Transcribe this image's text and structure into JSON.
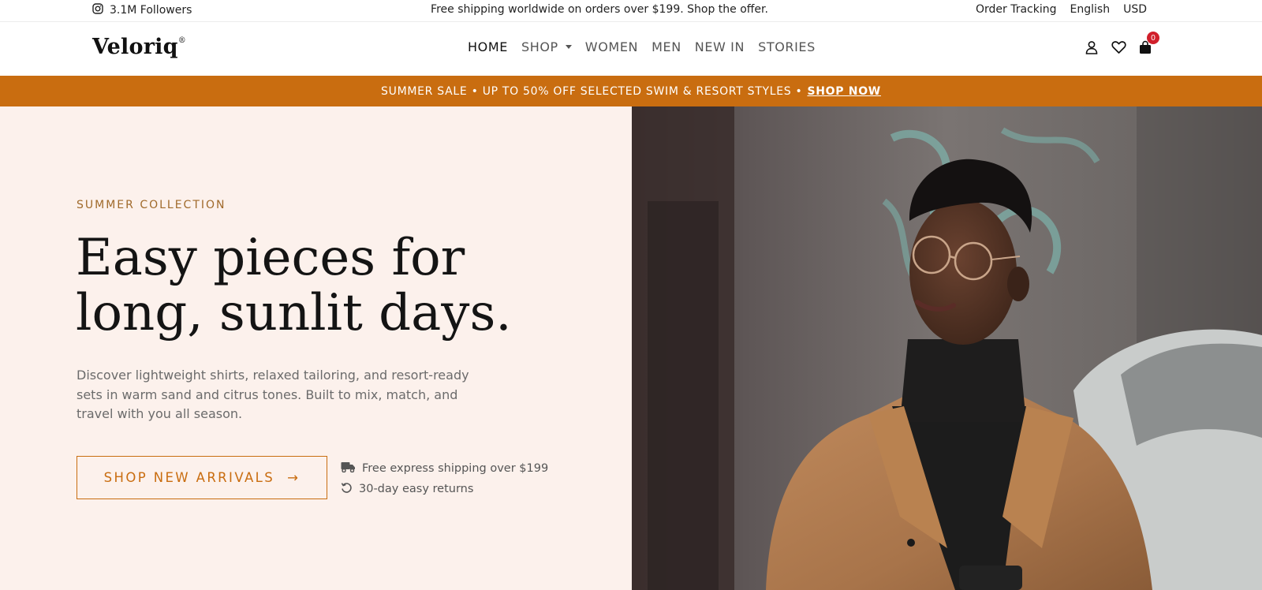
{
  "topbar": {
    "followers_icon": "instagram-icon",
    "followers": "3.1M Followers",
    "promo": "Free shipping worldwide on orders over $199. Shop the offer.",
    "order_tracking": "Order Tracking",
    "language": "English",
    "currency": "USD"
  },
  "header": {
    "logo": "Veloriq",
    "logo_mark": "®",
    "nav": [
      {
        "label": "HOME",
        "active": true
      },
      {
        "label": "SHOP",
        "has_dropdown": true
      },
      {
        "label": "WOMEN"
      },
      {
        "label": "MEN"
      },
      {
        "label": "NEW IN"
      },
      {
        "label": "STORIES"
      }
    ],
    "icons": [
      "user-icon",
      "heart-icon",
      "bag-icon"
    ],
    "cart_count": "0"
  },
  "banner": {
    "text": "SUMMER SALE • UP TO 50% OFF SELECTED SWIM & RESORT STYLES •",
    "link": "SHOP NOW"
  },
  "hero": {
    "eyebrow": "SUMMER COLLECTION",
    "headline": "Easy pieces for long, sunlit days.",
    "description": "Discover lightweight shirts, relaxed tailoring, and resort-ready sets in warm sand and citrus tones. Built to mix, match, and travel with you all season.",
    "cta": "SHOP NEW ARRIVALS",
    "cta_arrow": "→",
    "perks": [
      {
        "icon": "truck-icon",
        "text": "Free express shipping over $199"
      },
      {
        "icon": "returns-icon",
        "text": "30-day easy returns"
      }
    ]
  },
  "colors": {
    "accent": "#c96d10",
    "hero_bg": "#fcf1ec",
    "badge": "#d11f2b"
  }
}
